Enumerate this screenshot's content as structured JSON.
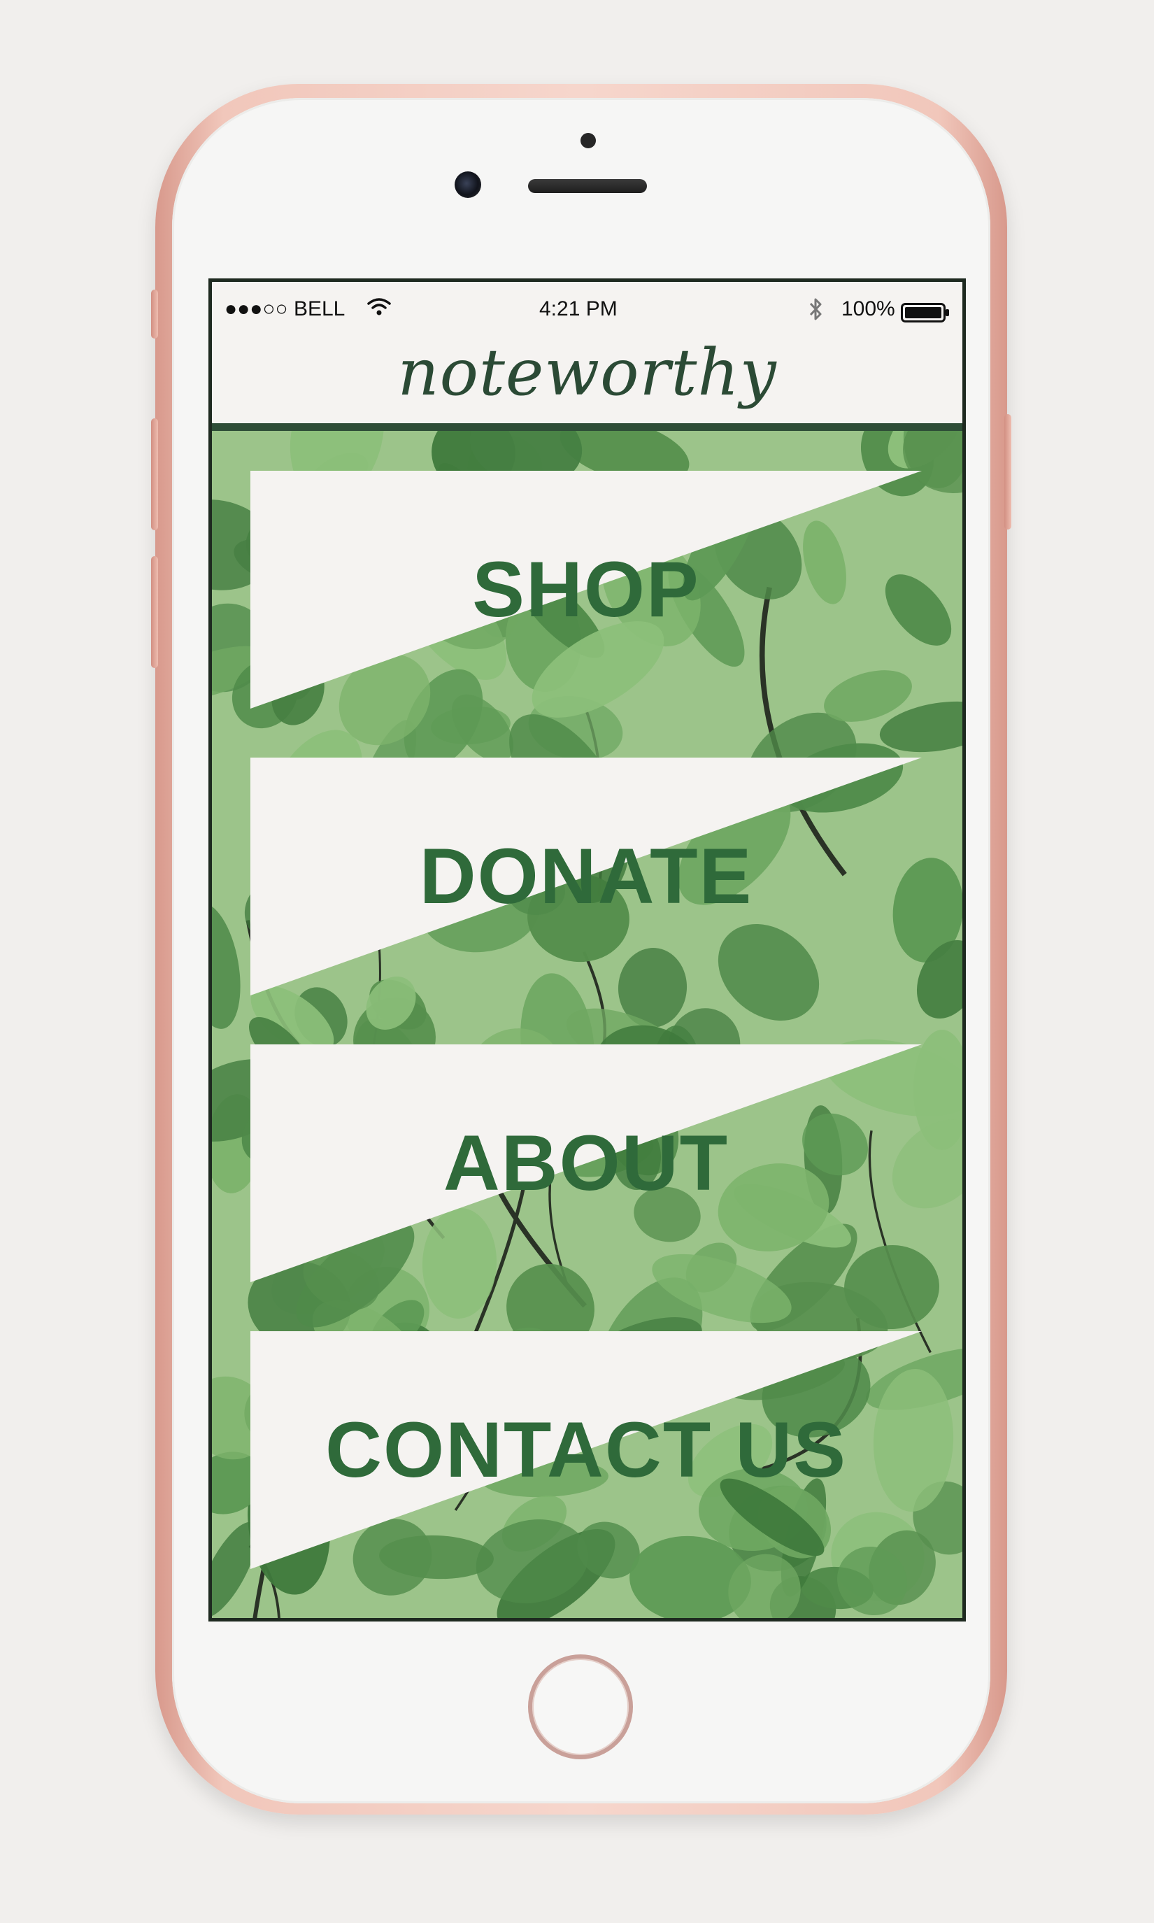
{
  "status_bar": {
    "signal": "●●●○○",
    "carrier": "BELL",
    "time": "4:21 PM",
    "battery": "100%",
    "icons": [
      "wifi-icon",
      "bluetooth-icon",
      "battery-icon"
    ]
  },
  "header": {
    "brand": "noteworthy"
  },
  "menu": [
    {
      "label": "SHOP"
    },
    {
      "label": "DONATE"
    },
    {
      "label": "ABOUT"
    },
    {
      "label": "CONTACT US"
    }
  ],
  "colors": {
    "brand_green": "#2b4a35",
    "header_rule": "#2e4d37",
    "banner": "#f5f3f1",
    "phone_rose": "#f1c7bb"
  }
}
